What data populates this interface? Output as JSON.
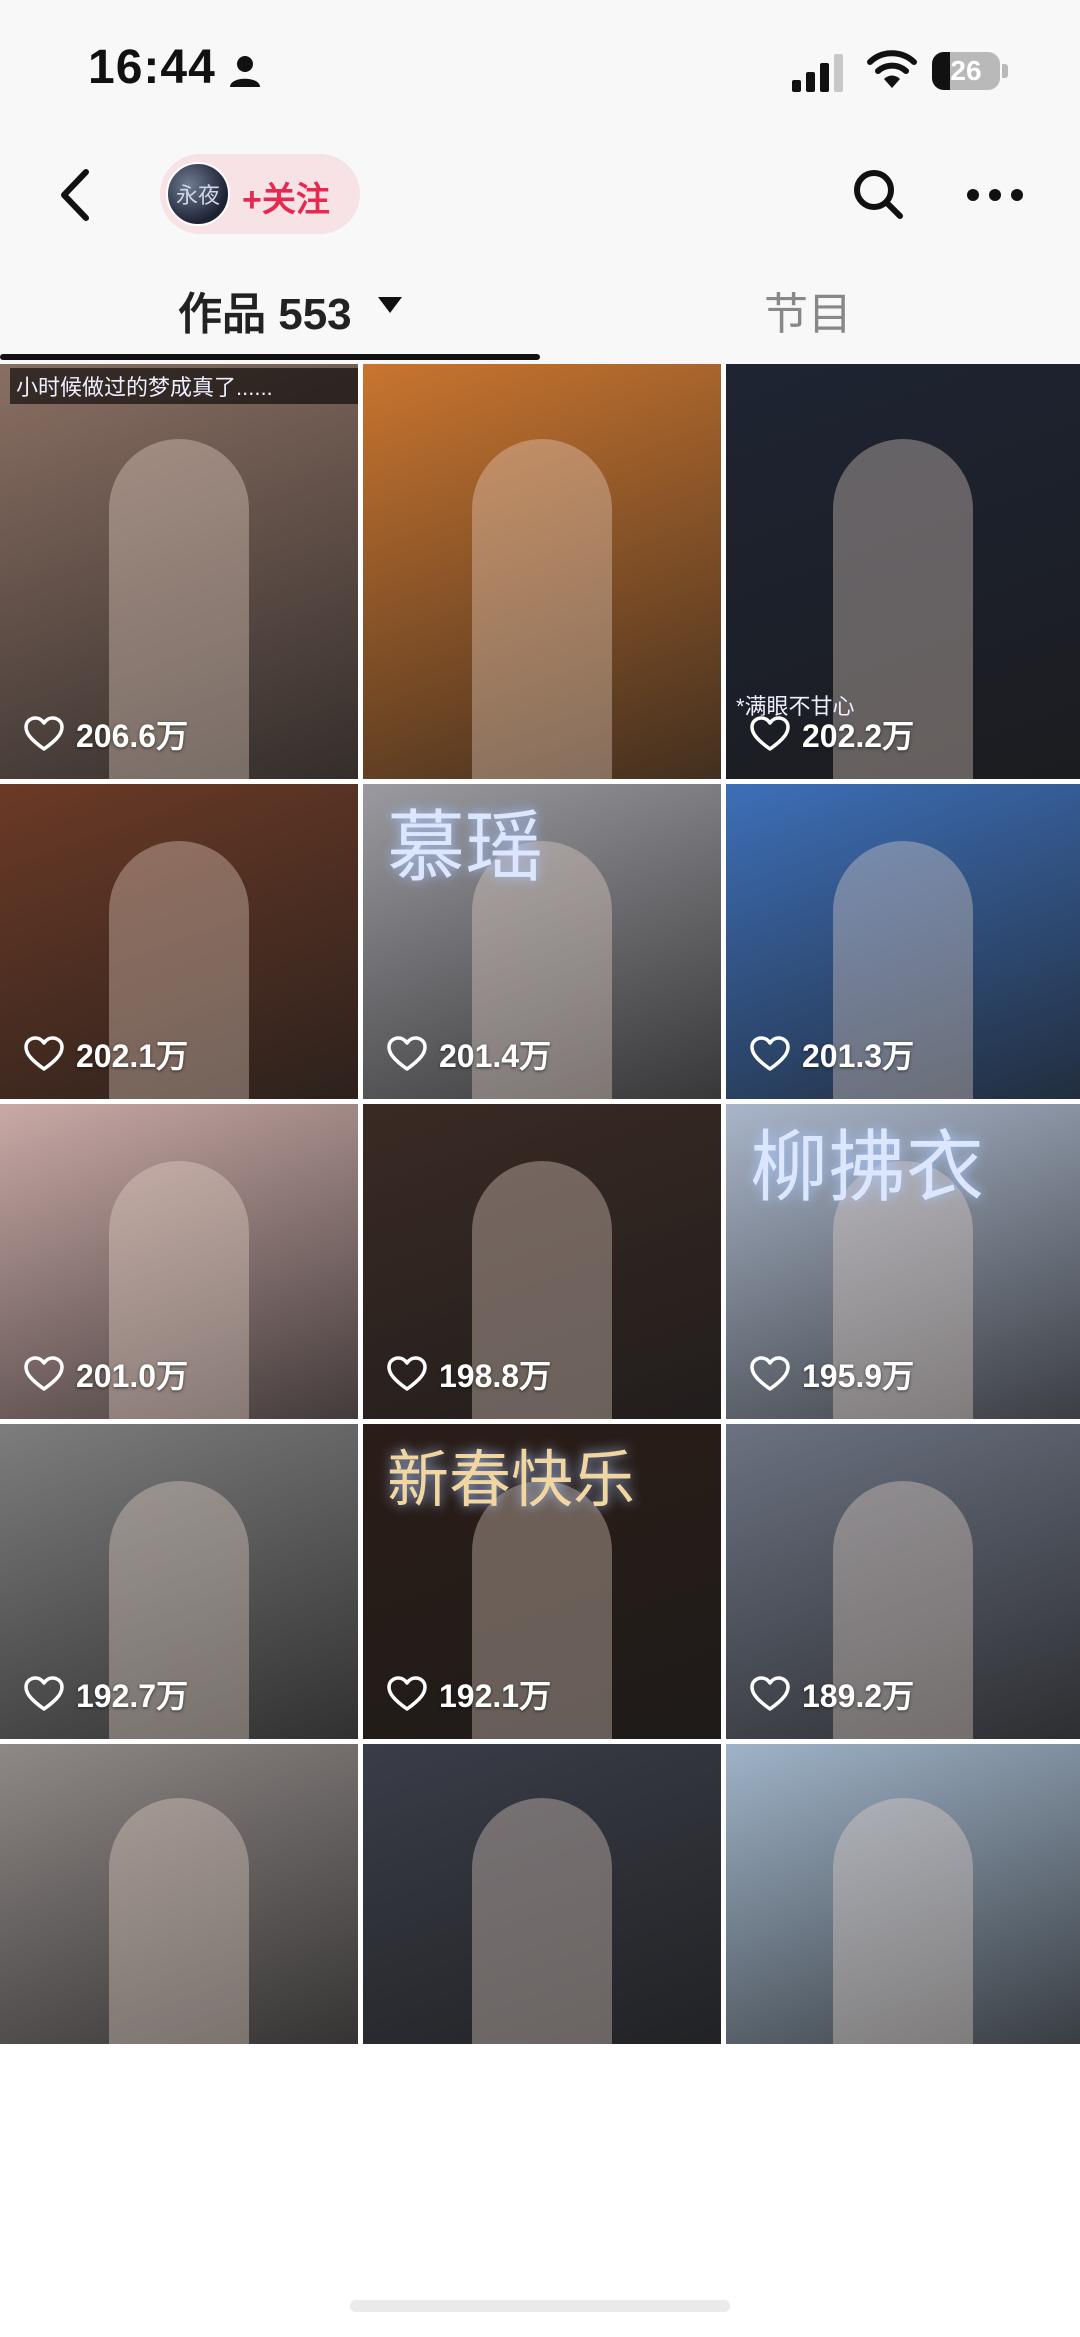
{
  "status_bar": {
    "time": "16:44",
    "battery": "26",
    "battery_level": 0.26
  },
  "nav": {
    "avatar_text": "永夜",
    "follow_label": "+关注"
  },
  "tabs": {
    "works_label": "作品 553",
    "shows_label": "节目"
  },
  "grid": {
    "tiles": [
      {
        "likes": "206.6万",
        "caption": "小时候做过的梦成真了......",
        "bg": "#8a6f63"
      },
      {
        "likes": "",
        "bg": "#c9752f"
      },
      {
        "likes": "202.2万",
        "caption": "*满眼不甘心",
        "bg": "#1e2433"
      },
      {
        "likes": "202.1万",
        "bg": "#6b3a26"
      },
      {
        "likes": "201.4万",
        "title": "慕瑶",
        "bg": "#9a9aa0"
      },
      {
        "likes": "201.3万",
        "bg": "#3d6fb8"
      },
      {
        "likes": "201.0万",
        "bg": "#c9a9a6"
      },
      {
        "likes": "198.8万",
        "bg": "#3a2a24"
      },
      {
        "likes": "195.9万",
        "title": "柳拂衣",
        "bg": "#a9b5c9"
      },
      {
        "likes": "192.7万",
        "bg": "#7d7d7d"
      },
      {
        "likes": "192.1万",
        "title": "新春快乐",
        "bg": "#2b1d17"
      },
      {
        "likes": "189.2万",
        "bg": "#6b7281"
      },
      {
        "likes": "",
        "bg": "#8f8886"
      },
      {
        "likes": "",
        "bg": "#3a3d48"
      },
      {
        "likes": "",
        "bg": "#9fb3c8"
      }
    ]
  }
}
